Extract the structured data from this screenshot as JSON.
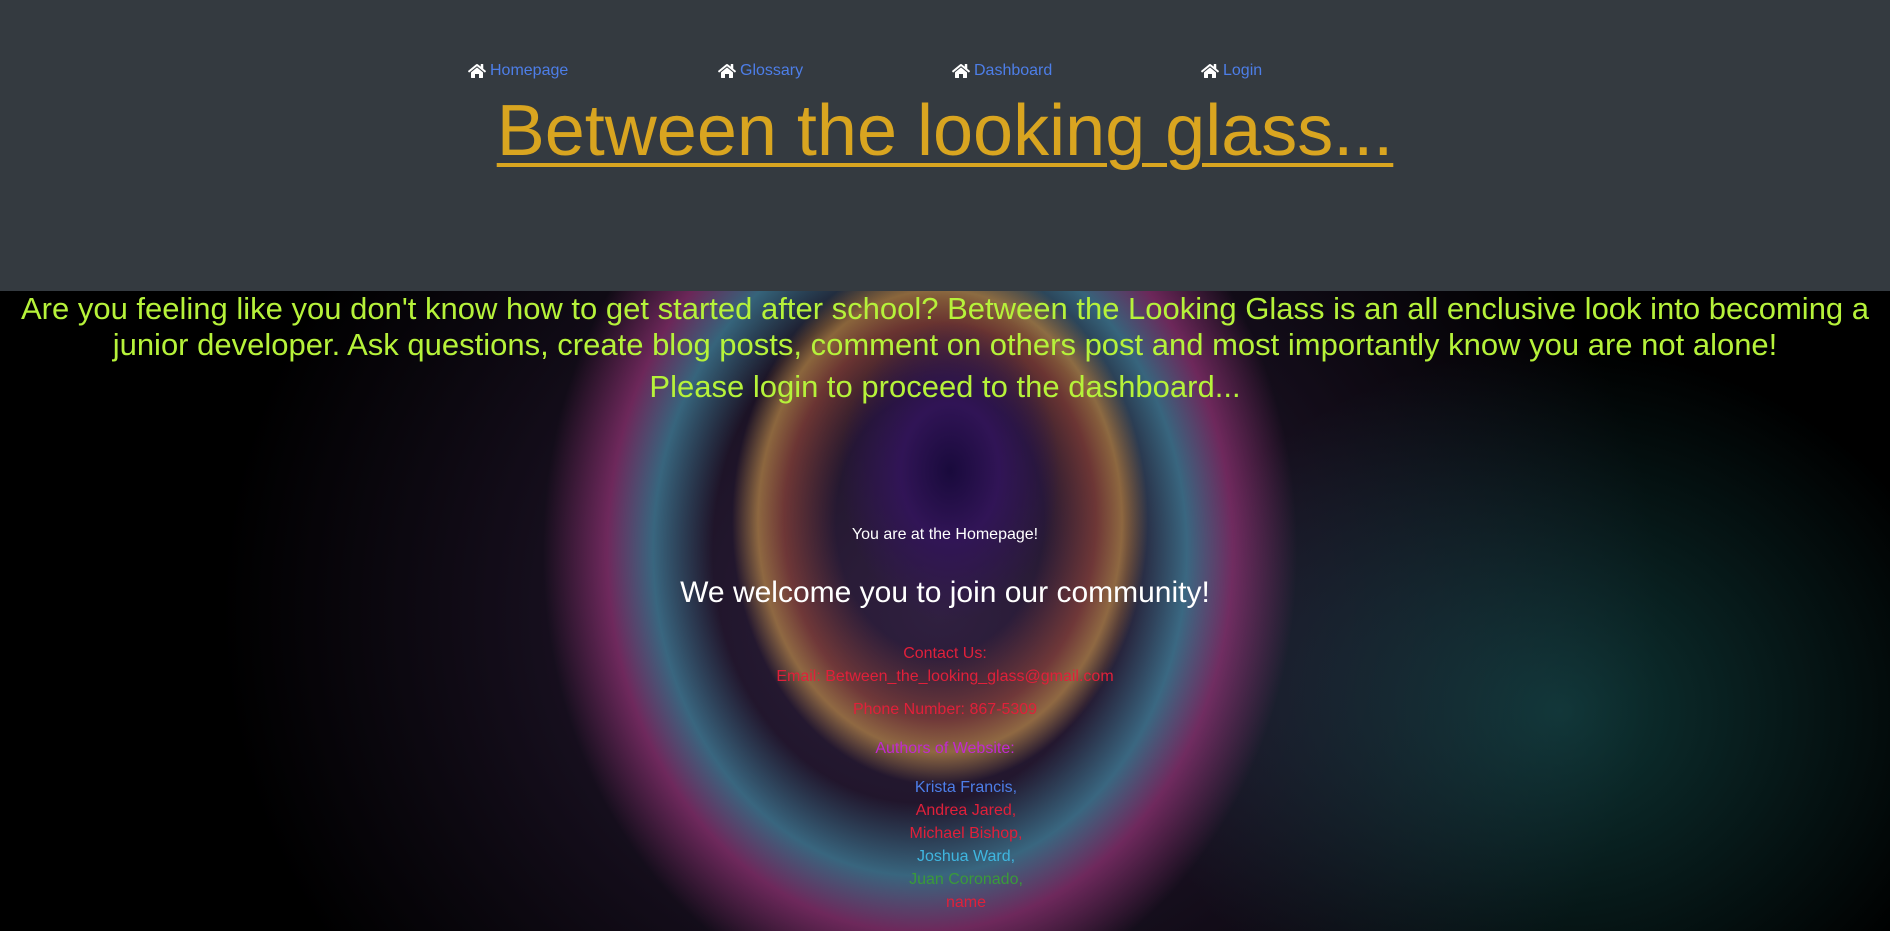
{
  "nav": {
    "items": [
      {
        "label": "Homepage",
        "icon": "home-icon"
      },
      {
        "label": "Glossary",
        "icon": "home-icon"
      },
      {
        "label": "Dashboard",
        "icon": "home-icon"
      },
      {
        "label": "Login",
        "icon": "home-icon"
      }
    ]
  },
  "header": {
    "title": "Between the looking glass..."
  },
  "intro": {
    "text": "Are you feeling like you don't know how to get started after school? Between the Looking Glass is an all enclusive look into becoming a junior developer. Ask questions, create blog posts, comment on others post and most importantly know you are not alone!",
    "login_prompt": "Please login to proceed to the dashboard..."
  },
  "main": {
    "location_text": "You are at the Homepage!",
    "welcome": "We welcome you to join our community!"
  },
  "contact": {
    "heading": "Contact Us:",
    "email": "Email: Between_the_looking_glass@gmail.com",
    "phone": "Phone Number: 867-5309"
  },
  "authors": {
    "heading": "Authors of Website:",
    "names": [
      {
        "name": "Krista Francis,",
        "color": "#4d7ee8"
      },
      {
        "name": "Andrea Jared,",
        "color": "#e0203a"
      },
      {
        "name": "Michael Bishop,",
        "color": "#e0203a"
      },
      {
        "name": "Joshua Ward,",
        "color": "#3fb6e0"
      },
      {
        "name": "Juan Coronado,",
        "color": "#3a9a3a"
      },
      {
        "name": "name",
        "color": "#e0203a"
      }
    ]
  },
  "colors": {
    "header_bg": "#343a40",
    "title": "#d9a520",
    "nav_link": "#4d7ee8",
    "intro_text": "#b6f23a",
    "contact_text": "#e0203a",
    "authors_heading": "#c12ad0"
  }
}
